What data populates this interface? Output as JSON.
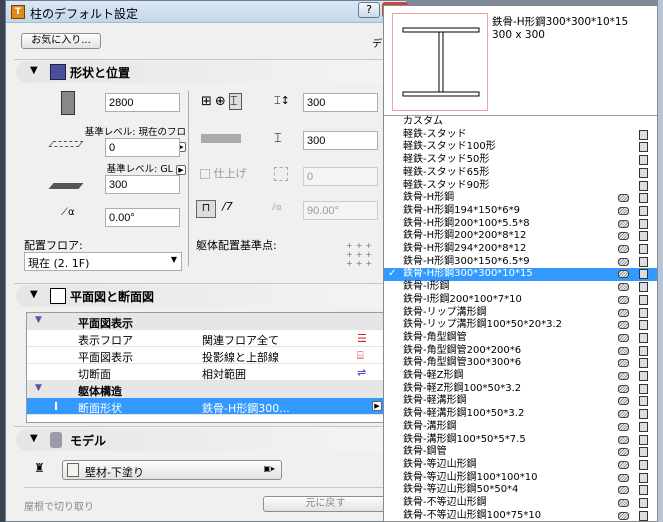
{
  "dialog": {
    "title": "柱のデフォルト設定",
    "help_label": "?",
    "favorites_button": "お気に入り...",
    "cut_label": "デ"
  },
  "shape_section": {
    "title": "形状と位置",
    "height_value": "2800",
    "top_ref_label": "基準レベル: 現在のフロア",
    "top_offset_value": "0",
    "bottom_ref_label": "基準レベル: GL",
    "bottom_offset_value": "300",
    "rotation_value": "0.00°",
    "home_floor_label": "配置フロア:",
    "home_floor_value": "現在 (2. 1F)",
    "width_value": "300",
    "depth_value": "300",
    "finish_checkbox_label": "仕上げ",
    "finish_value": "0",
    "slant_value": "90.00°",
    "anchor_label": "躯体配置基準点:"
  },
  "plan_section": {
    "title": "平面図と断面図",
    "rows": [
      {
        "type": "group",
        "name": "平面図表示"
      },
      {
        "type": "item",
        "name": "表示フロア",
        "value": "関連フロア全て"
      },
      {
        "type": "item",
        "name": "平面図表示",
        "value": "投影線と上部線"
      },
      {
        "type": "item",
        "name": "切断面",
        "value": "相対範囲"
      },
      {
        "type": "group",
        "name": "躯体構造"
      },
      {
        "type": "selected",
        "name": "断面形状",
        "value": "鉄骨-H形鋼300..."
      }
    ]
  },
  "model_section": {
    "title": "モデル",
    "material_value": "壁材-下塗り",
    "trim_label": "屋根で切り取り",
    "reset_button": "元に戻す"
  },
  "profile_popup": {
    "preview_name": "鉄骨-H形鋼300*300*10*15",
    "preview_size": "300 x 300",
    "check_mark": "✓",
    "items": [
      {
        "label": "カスタム",
        "icons": 0
      },
      {
        "label": "軽鉄-スタッド",
        "icons": 1
      },
      {
        "label": "軽鉄-スタッド100形",
        "icons": 1
      },
      {
        "label": "軽鉄-スタッド50形",
        "icons": 1
      },
      {
        "label": "軽鉄-スタッド65形",
        "icons": 1
      },
      {
        "label": "軽鉄-スタッド90形",
        "icons": 1
      },
      {
        "label": "鉄骨-H形鋼",
        "icons": 2
      },
      {
        "label": "鉄骨-H形鋼194*150*6*9",
        "icons": 2
      },
      {
        "label": "鉄骨-H形鋼200*100*5.5*8",
        "icons": 2
      },
      {
        "label": "鉄骨-H形鋼200*200*8*12",
        "icons": 2
      },
      {
        "label": "鉄骨-H形鋼294*200*8*12",
        "icons": 2
      },
      {
        "label": "鉄骨-H形鋼300*150*6.5*9",
        "icons": 2
      },
      {
        "label": "鉄骨-H形鋼300*300*10*15",
        "icons": 2,
        "selected": true
      },
      {
        "label": "鉄骨-I形鋼",
        "icons": 2
      },
      {
        "label": "鉄骨-I形鋼200*100*7*10",
        "icons": 2
      },
      {
        "label": "鉄骨-リップ溝形鋼",
        "icons": 2
      },
      {
        "label": "鉄骨-リップ溝形鋼100*50*20*3.2",
        "icons": 2
      },
      {
        "label": "鉄骨-角型鋼管",
        "icons": 2
      },
      {
        "label": "鉄骨-角型鋼管200*200*6",
        "icons": 2
      },
      {
        "label": "鉄骨-角型鋼管300*300*6",
        "icons": 2
      },
      {
        "label": "鉄骨-軽Z形鋼",
        "icons": 2
      },
      {
        "label": "鉄骨-軽Z形鋼100*50*3.2",
        "icons": 2
      },
      {
        "label": "鉄骨-軽溝形鋼",
        "icons": 2
      },
      {
        "label": "鉄骨-軽溝形鋼100*50*3.2",
        "icons": 2
      },
      {
        "label": "鉄骨-溝形鋼",
        "icons": 2
      },
      {
        "label": "鉄骨-溝形鋼100*50*5*7.5",
        "icons": 2
      },
      {
        "label": "鉄骨-鋼管",
        "icons": 2
      },
      {
        "label": "鉄骨-等辺山形鋼",
        "icons": 2
      },
      {
        "label": "鉄骨-等辺山形鋼100*100*10",
        "icons": 2
      },
      {
        "label": "鉄骨-等辺山形鋼50*50*4",
        "icons": 2
      },
      {
        "label": "鉄骨-不等辺山形鋼",
        "icons": 2
      },
      {
        "label": "鉄骨-不等辺山形鋼100*75*10",
        "icons": 2
      }
    ]
  }
}
